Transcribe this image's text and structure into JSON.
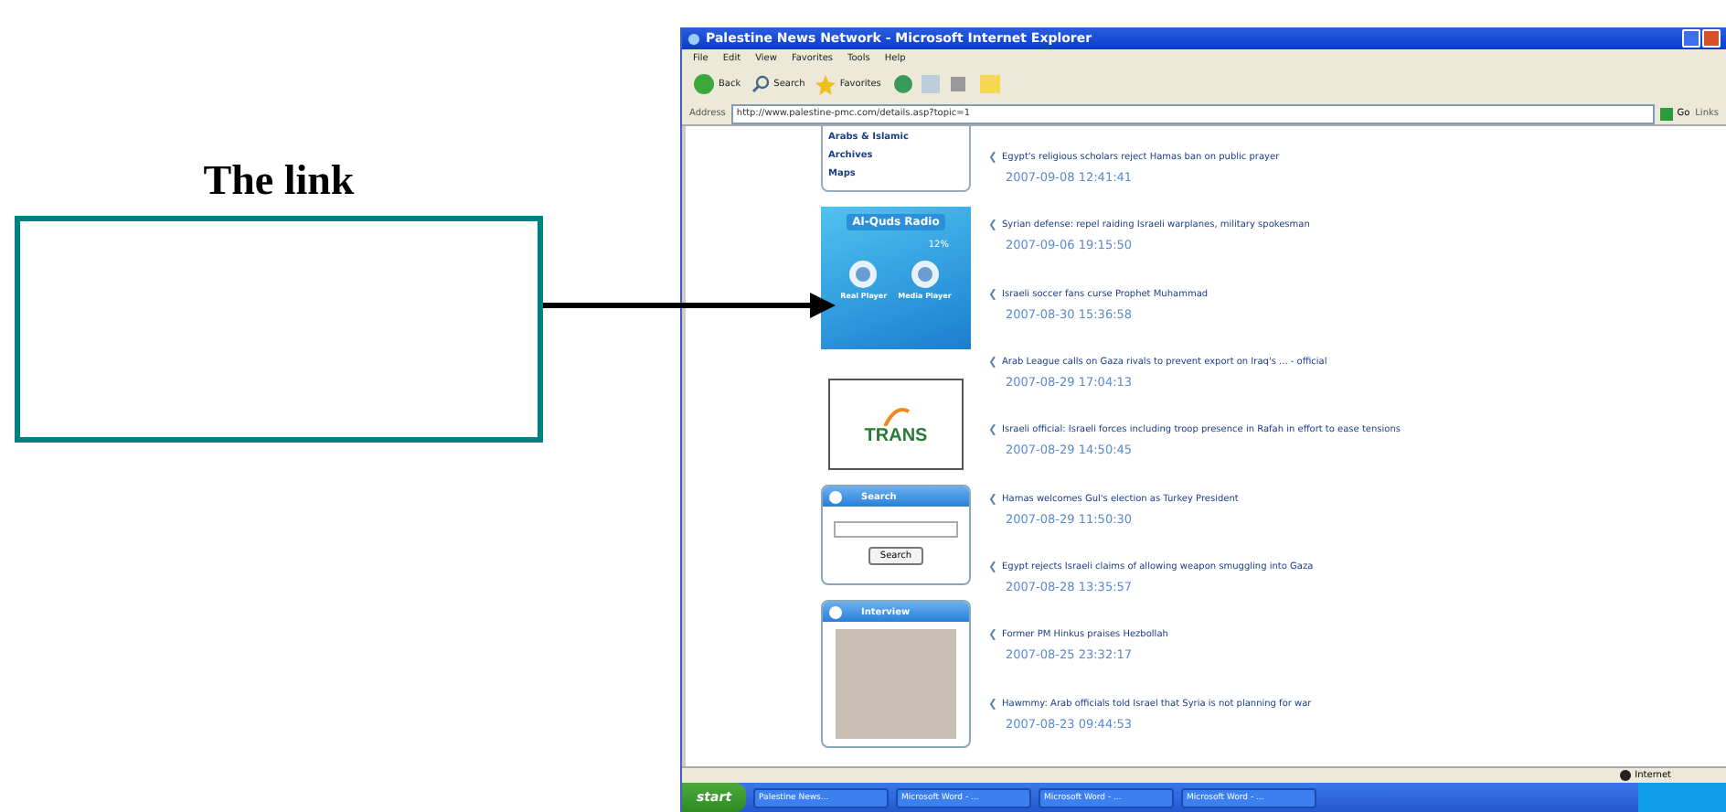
{
  "figure": {
    "caption": "The link"
  },
  "window": {
    "title": "Palestine News Network - Microsoft Internet Explorer",
    "menu": [
      "File",
      "Edit",
      "View",
      "Favorites",
      "Tools",
      "Help"
    ],
    "toolbar": [
      "Back",
      "Search",
      "Favorites"
    ],
    "address_label": "Address",
    "url": "http://www.palestine-pmc.com/details.asp?topic=1",
    "go": "Go",
    "links": "Links"
  },
  "sidebar": {
    "links": [
      "Arabs & Islamic",
      "Archives",
      "Maps"
    ],
    "radio": {
      "title": "Al-Quds Radio",
      "reading": "12%",
      "players": [
        "Real Player",
        "Media Player"
      ]
    },
    "logo": "TRANS",
    "search": {
      "title": "Search",
      "button": "Search"
    },
    "interview": {
      "title": "Interview"
    }
  },
  "news": [
    {
      "headline": "Egypt's religious scholars reject Hamas ban on public prayer",
      "date": "2007-09-08 12:41:41"
    },
    {
      "headline": "Syrian defense: repel raiding Israeli warplanes, military spokesman",
      "date": "2007-09-06 19:15:50"
    },
    {
      "headline": "Israeli soccer fans curse Prophet Muhammad",
      "date": "2007-08-30 15:36:58"
    },
    {
      "headline": "Arab League calls on Gaza rivals to prevent export on Iraq's ... - official",
      "date": "2007-08-29 17:04:13"
    },
    {
      "headline": "Israeli official: Israeli forces including troop presence in Rafah in effort to ease tensions",
      "date": "2007-08-29 14:50:45"
    },
    {
      "headline": "Hamas welcomes Gul's election as Turkey President",
      "date": "2007-08-29 11:50:30"
    },
    {
      "headline": "Egypt rejects Israeli claims of allowing weapon smuggling into Gaza",
      "date": "2007-08-28 13:35:57"
    },
    {
      "headline": "Former PM Hinkus praises Hezbollah",
      "date": "2007-08-25 23:32:17"
    },
    {
      "headline": "Hawmmy: Arab officials told Israel that Syria is not planning for war",
      "date": "2007-08-23 09:44:53"
    }
  ],
  "status_bar": {
    "zone": "Internet"
  },
  "taskbar": {
    "start": "start",
    "tasks": [
      "Palestine News...",
      "Microsoft Word - ...",
      "Microsoft Word - ...",
      "Microsoft Word - ..."
    ]
  }
}
